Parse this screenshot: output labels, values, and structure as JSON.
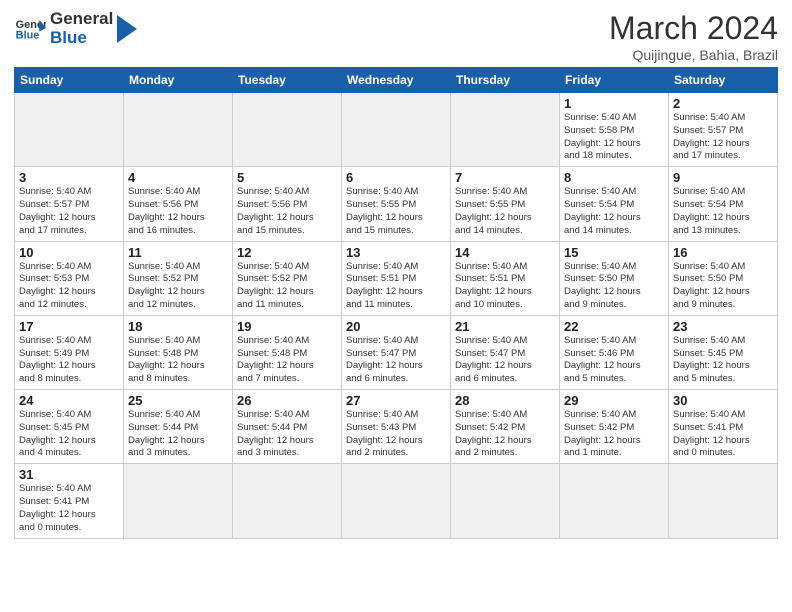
{
  "logo": {
    "text_general": "General",
    "text_blue": "Blue"
  },
  "header": {
    "month_year": "March 2024",
    "location": "Quijingue, Bahia, Brazil"
  },
  "days_of_week": [
    "Sunday",
    "Monday",
    "Tuesday",
    "Wednesday",
    "Thursday",
    "Friday",
    "Saturday"
  ],
  "weeks": [
    [
      {
        "day": "",
        "info": "",
        "empty": true
      },
      {
        "day": "",
        "info": "",
        "empty": true
      },
      {
        "day": "",
        "info": "",
        "empty": true
      },
      {
        "day": "",
        "info": "",
        "empty": true
      },
      {
        "day": "",
        "info": "",
        "empty": true
      },
      {
        "day": "1",
        "info": "Sunrise: 5:40 AM\nSunset: 5:58 PM\nDaylight: 12 hours\nand 18 minutes."
      },
      {
        "day": "2",
        "info": "Sunrise: 5:40 AM\nSunset: 5:57 PM\nDaylight: 12 hours\nand 17 minutes."
      }
    ],
    [
      {
        "day": "3",
        "info": "Sunrise: 5:40 AM\nSunset: 5:57 PM\nDaylight: 12 hours\nand 17 minutes."
      },
      {
        "day": "4",
        "info": "Sunrise: 5:40 AM\nSunset: 5:56 PM\nDaylight: 12 hours\nand 16 minutes."
      },
      {
        "day": "5",
        "info": "Sunrise: 5:40 AM\nSunset: 5:56 PM\nDaylight: 12 hours\nand 15 minutes."
      },
      {
        "day": "6",
        "info": "Sunrise: 5:40 AM\nSunset: 5:55 PM\nDaylight: 12 hours\nand 15 minutes."
      },
      {
        "day": "7",
        "info": "Sunrise: 5:40 AM\nSunset: 5:55 PM\nDaylight: 12 hours\nand 14 minutes."
      },
      {
        "day": "8",
        "info": "Sunrise: 5:40 AM\nSunset: 5:54 PM\nDaylight: 12 hours\nand 14 minutes."
      },
      {
        "day": "9",
        "info": "Sunrise: 5:40 AM\nSunset: 5:54 PM\nDaylight: 12 hours\nand 13 minutes."
      }
    ],
    [
      {
        "day": "10",
        "info": "Sunrise: 5:40 AM\nSunset: 5:53 PM\nDaylight: 12 hours\nand 12 minutes."
      },
      {
        "day": "11",
        "info": "Sunrise: 5:40 AM\nSunset: 5:52 PM\nDaylight: 12 hours\nand 12 minutes."
      },
      {
        "day": "12",
        "info": "Sunrise: 5:40 AM\nSunset: 5:52 PM\nDaylight: 12 hours\nand 11 minutes."
      },
      {
        "day": "13",
        "info": "Sunrise: 5:40 AM\nSunset: 5:51 PM\nDaylight: 12 hours\nand 11 minutes."
      },
      {
        "day": "14",
        "info": "Sunrise: 5:40 AM\nSunset: 5:51 PM\nDaylight: 12 hours\nand 10 minutes."
      },
      {
        "day": "15",
        "info": "Sunrise: 5:40 AM\nSunset: 5:50 PM\nDaylight: 12 hours\nand 9 minutes."
      },
      {
        "day": "16",
        "info": "Sunrise: 5:40 AM\nSunset: 5:50 PM\nDaylight: 12 hours\nand 9 minutes."
      }
    ],
    [
      {
        "day": "17",
        "info": "Sunrise: 5:40 AM\nSunset: 5:49 PM\nDaylight: 12 hours\nand 8 minutes."
      },
      {
        "day": "18",
        "info": "Sunrise: 5:40 AM\nSunset: 5:48 PM\nDaylight: 12 hours\nand 8 minutes."
      },
      {
        "day": "19",
        "info": "Sunrise: 5:40 AM\nSunset: 5:48 PM\nDaylight: 12 hours\nand 7 minutes."
      },
      {
        "day": "20",
        "info": "Sunrise: 5:40 AM\nSunset: 5:47 PM\nDaylight: 12 hours\nand 6 minutes."
      },
      {
        "day": "21",
        "info": "Sunrise: 5:40 AM\nSunset: 5:47 PM\nDaylight: 12 hours\nand 6 minutes."
      },
      {
        "day": "22",
        "info": "Sunrise: 5:40 AM\nSunset: 5:46 PM\nDaylight: 12 hours\nand 5 minutes."
      },
      {
        "day": "23",
        "info": "Sunrise: 5:40 AM\nSunset: 5:45 PM\nDaylight: 12 hours\nand 5 minutes."
      }
    ],
    [
      {
        "day": "24",
        "info": "Sunrise: 5:40 AM\nSunset: 5:45 PM\nDaylight: 12 hours\nand 4 minutes."
      },
      {
        "day": "25",
        "info": "Sunrise: 5:40 AM\nSunset: 5:44 PM\nDaylight: 12 hours\nand 3 minutes."
      },
      {
        "day": "26",
        "info": "Sunrise: 5:40 AM\nSunset: 5:44 PM\nDaylight: 12 hours\nand 3 minutes."
      },
      {
        "day": "27",
        "info": "Sunrise: 5:40 AM\nSunset: 5:43 PM\nDaylight: 12 hours\nand 2 minutes."
      },
      {
        "day": "28",
        "info": "Sunrise: 5:40 AM\nSunset: 5:42 PM\nDaylight: 12 hours\nand 2 minutes."
      },
      {
        "day": "29",
        "info": "Sunrise: 5:40 AM\nSunset: 5:42 PM\nDaylight: 12 hours\nand 1 minute."
      },
      {
        "day": "30",
        "info": "Sunrise: 5:40 AM\nSunset: 5:41 PM\nDaylight: 12 hours\nand 0 minutes."
      }
    ],
    [
      {
        "day": "31",
        "info": "Sunrise: 5:40 AM\nSunset: 5:41 PM\nDaylight: 12 hours\nand 0 minutes."
      },
      {
        "day": "",
        "info": "",
        "empty": true
      },
      {
        "day": "",
        "info": "",
        "empty": true
      },
      {
        "day": "",
        "info": "",
        "empty": true
      },
      {
        "day": "",
        "info": "",
        "empty": true
      },
      {
        "day": "",
        "info": "",
        "empty": true
      },
      {
        "day": "",
        "info": "",
        "empty": true
      }
    ]
  ]
}
